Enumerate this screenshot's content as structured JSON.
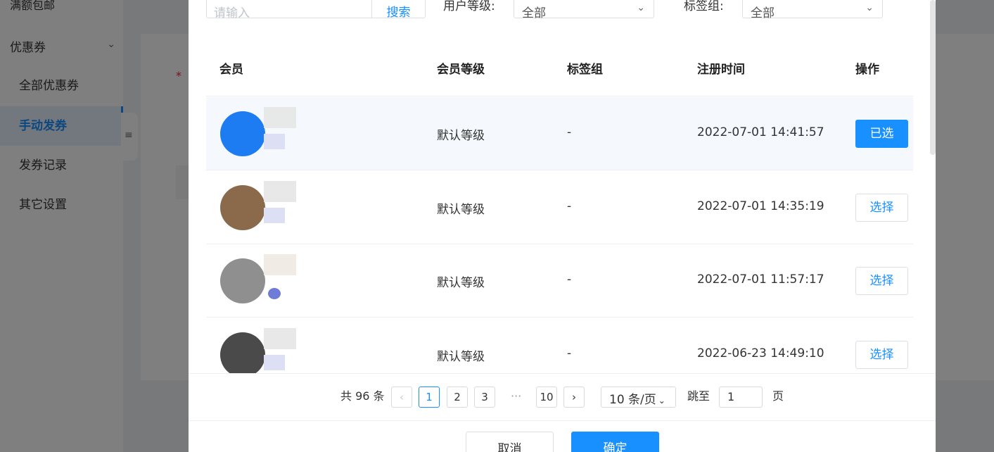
{
  "sidebar": {
    "top_item": "满额包邮",
    "group_label": "优惠券",
    "items": [
      {
        "label": "全部优惠券"
      },
      {
        "label": "手动发券"
      },
      {
        "label": "发券记录"
      },
      {
        "label": "其它设置"
      }
    ]
  },
  "filters": {
    "search_placeholder": "请输入",
    "search_button": "搜索",
    "level_label": "用户等级:",
    "level_value": "全部",
    "tag_label": "标签组:",
    "tag_value": "全部"
  },
  "table": {
    "columns": [
      "会员",
      "会员等级",
      "标签组",
      "注册时间",
      "操作"
    ],
    "rows": [
      {
        "level": "默认等级",
        "tag": "-",
        "time": "2022-07-01 14:41:57",
        "action": "已选",
        "selected": true
      },
      {
        "level": "默认等级",
        "tag": "-",
        "time": "2022-07-01 14:35:19",
        "action": "选择",
        "selected": false
      },
      {
        "level": "默认等级",
        "tag": "-",
        "time": "2022-07-01 11:57:17",
        "action": "选择",
        "selected": false
      },
      {
        "level": "默认等级",
        "tag": "-",
        "time": "2022-06-23 14:49:10",
        "action": "选择",
        "selected": false
      }
    ]
  },
  "pagination": {
    "total": "共 96 条",
    "pages": [
      "1",
      "2",
      "3",
      "···",
      "10"
    ],
    "current": "1",
    "page_size": "10 条/页",
    "jump_label": "跳至",
    "jump_value": "1",
    "page_suffix": "页"
  },
  "footer": {
    "cancel": "取消",
    "confirm": "确定"
  },
  "colors": {
    "accent": "#1890ff",
    "overlay": "rgba(0,0,0,0.5)"
  }
}
